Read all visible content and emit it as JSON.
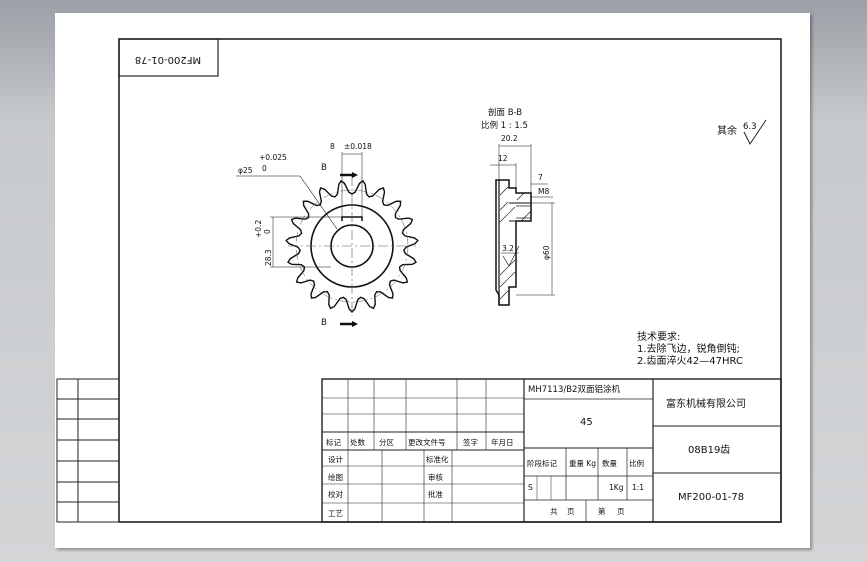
{
  "drawing_number_rotated": "MF200-01-78",
  "section": {
    "title": "剖面 B-B",
    "scale": "比例 1 : 1.5",
    "dim_width": "20.2",
    "dim_hub": "12",
    "dim_tooth": "7",
    "dim_thread": "M8",
    "dim_roughness": "3.2",
    "dim_diameter": "φ60"
  },
  "front_view": {
    "dim_bore": "φ25",
    "bore_tol_upper": "+0.025",
    "bore_tol_lower": "0",
    "dim_key": "8",
    "key_tol": "±0.018",
    "dim_keydepth": "28.3",
    "keydepth_tol_upper": "+0.2",
    "keydepth_tol_lower": "0",
    "section_mark_top": "B",
    "section_mark_bottom": "B"
  },
  "roughness_note": {
    "label": "其余",
    "value": "6.3"
  },
  "tech_requirements": {
    "heading": "技术要求:",
    "line1": "1.去除飞边，锐角倒钝;",
    "line2": "2.齿面淬火42—47HRC"
  },
  "title_block": {
    "project": "MH7113/B2双面铝涂机",
    "company": "富东机械有限公司",
    "material": "45",
    "part_name": "08B19齿",
    "drawing_number": "MF200-01-78",
    "rev_headers": [
      "标记",
      "处数",
      "分区",
      "更改文件号",
      "签字",
      "年月日"
    ],
    "roles": [
      "设计",
      "绘图",
      "校对",
      "工艺"
    ],
    "roles_right": [
      "标准化",
      "审核",
      "批准"
    ],
    "stage_headers": [
      "阶段标记",
      "重量 Kg",
      "比例"
    ],
    "stage_value": "S",
    "weight": "1Kg",
    "scale_value": "1:1",
    "sheets_total_label": "共",
    "sheets_unit1": "页",
    "sheet_label": "第",
    "sheets_unit2": "页",
    "qty_label": "数量"
  }
}
